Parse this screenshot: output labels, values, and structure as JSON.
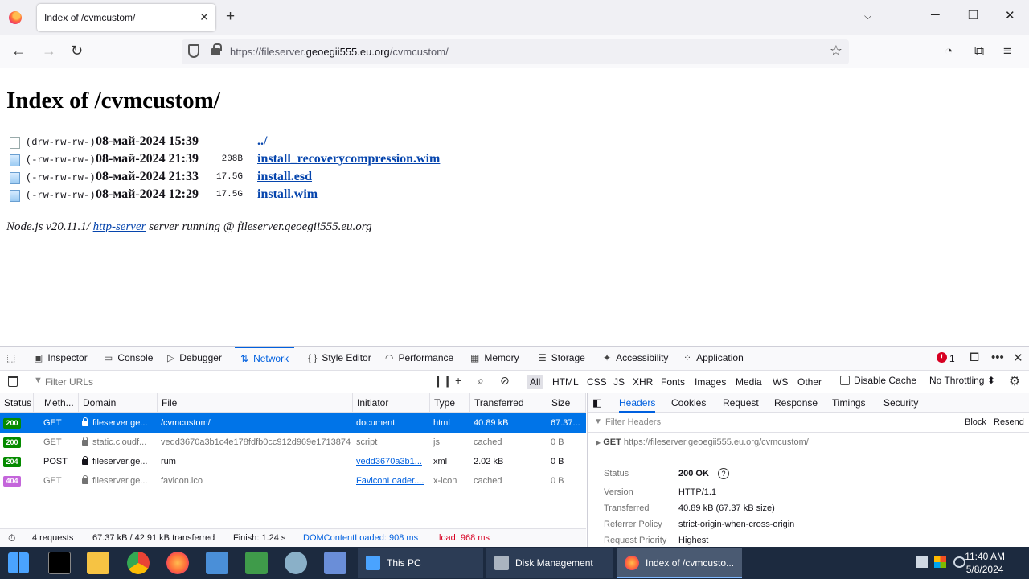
{
  "browser": {
    "tab_title": "Index of /cvmcustom/",
    "url_prefix": "https://fileserver.",
    "url_host": "geoegii555.eu.org",
    "url_path": "/cvmcustom/"
  },
  "page": {
    "title": "Index of /cvmcustom/",
    "files": [
      {
        "perm": "(drw-rw-rw-)",
        "date": "08-май-2024 15:39",
        "size": "",
        "name": "../",
        "icon": "folder-icon"
      },
      {
        "perm": "(-rw-rw-rw-)",
        "date": "08-май-2024 21:39",
        "size": "208B",
        "name": "install_recoverycompression.wim",
        "icon": "file-icon"
      },
      {
        "perm": "(-rw-rw-rw-)",
        "date": "08-май-2024 21:33",
        "size": "17.5G",
        "name": "install.esd",
        "icon": "file-icon"
      },
      {
        "perm": "(-rw-rw-rw-)",
        "date": "08-май-2024 12:29",
        "size": "17.5G",
        "name": "install.wim",
        "icon": "file-icon"
      }
    ],
    "footer_prefix": "Node.js v20.11.1/",
    "footer_link": "http-server",
    "footer_suffix": "server running @ fileserver.geoegii555.eu.org"
  },
  "devtools": {
    "tabs": [
      "Inspector",
      "Console",
      "Debugger",
      "Network",
      "Style Editor",
      "Performance",
      "Memory",
      "Storage",
      "Accessibility",
      "Application"
    ],
    "error_count": "1",
    "filter_placeholder": "Filter URLs",
    "type_filters": [
      "All",
      "HTML",
      "CSS",
      "JS",
      "XHR",
      "Fonts",
      "Images",
      "Media",
      "WS",
      "Other"
    ],
    "disable_cache": "Disable Cache",
    "throttling": "No Throttling ⬍",
    "columns": [
      "Status",
      "Meth...",
      "Domain",
      "File",
      "Initiator",
      "Type",
      "Transferred",
      "Size"
    ],
    "requests": [
      {
        "status": "200",
        "method": "GET",
        "domain": "fileserver.ge...",
        "file": "/cvmcustom/",
        "initiator": "document",
        "type": "html",
        "transferred": "40.89 kB",
        "size": "67.37..."
      },
      {
        "status": "200",
        "method": "GET",
        "domain": "static.cloudf...",
        "file": "vedd3670a3b1c4e178fdfb0cc912d969e1713874",
        "initiator": "script",
        "type": "js",
        "transferred": "cached",
        "size": "0 B"
      },
      {
        "status": "204",
        "method": "POST",
        "domain": "fileserver.ge...",
        "file": "rum",
        "initiator": "vedd3670a3b1...",
        "type": "xml",
        "transferred": "2.02 kB",
        "size": "0 B"
      },
      {
        "status": "404",
        "method": "GET",
        "domain": "fileserver.ge...",
        "file": "favicon.ico",
        "initiator": "FaviconLoader....",
        "type": "x-icon",
        "transferred": "cached",
        "size": "0 B"
      }
    ],
    "summary": {
      "requests": "4 requests",
      "transferred": "67.37 kB / 42.91 kB transferred",
      "finish": "Finish: 1.24 s",
      "dcl": "DOMContentLoaded: 908 ms",
      "load": "load: 968 ms"
    },
    "side_tabs": [
      "Headers",
      "Cookies",
      "Request",
      "Response",
      "Timings",
      "Security"
    ],
    "filter_headers": "Filter Headers",
    "block": "Block",
    "resend": "Resend",
    "get_method": "GET",
    "get_url": "https://fileserver.geoegii555.eu.org/cvmcustom/",
    "details": [
      {
        "key": "Status",
        "value": "200 OK"
      },
      {
        "key": "Version",
        "value": "HTTP/1.1"
      },
      {
        "key": "Transferred",
        "value": "40.89 kB (67.37 kB size)"
      },
      {
        "key": "Referrer Policy",
        "value": "strict-origin-when-cross-origin"
      },
      {
        "key": "Request Priority",
        "value": "Highest"
      }
    ]
  },
  "taskbar": {
    "windows": [
      "This PC",
      "Disk Management",
      "Index of /cvmcusto..."
    ],
    "time": "11:40 AM",
    "date": "5/8/2024"
  },
  "colors": {
    "accent": "#0060df",
    "ok": "#058b00",
    "selected_row": "#0074e8",
    "taskbar": "#1c2a3f"
  }
}
